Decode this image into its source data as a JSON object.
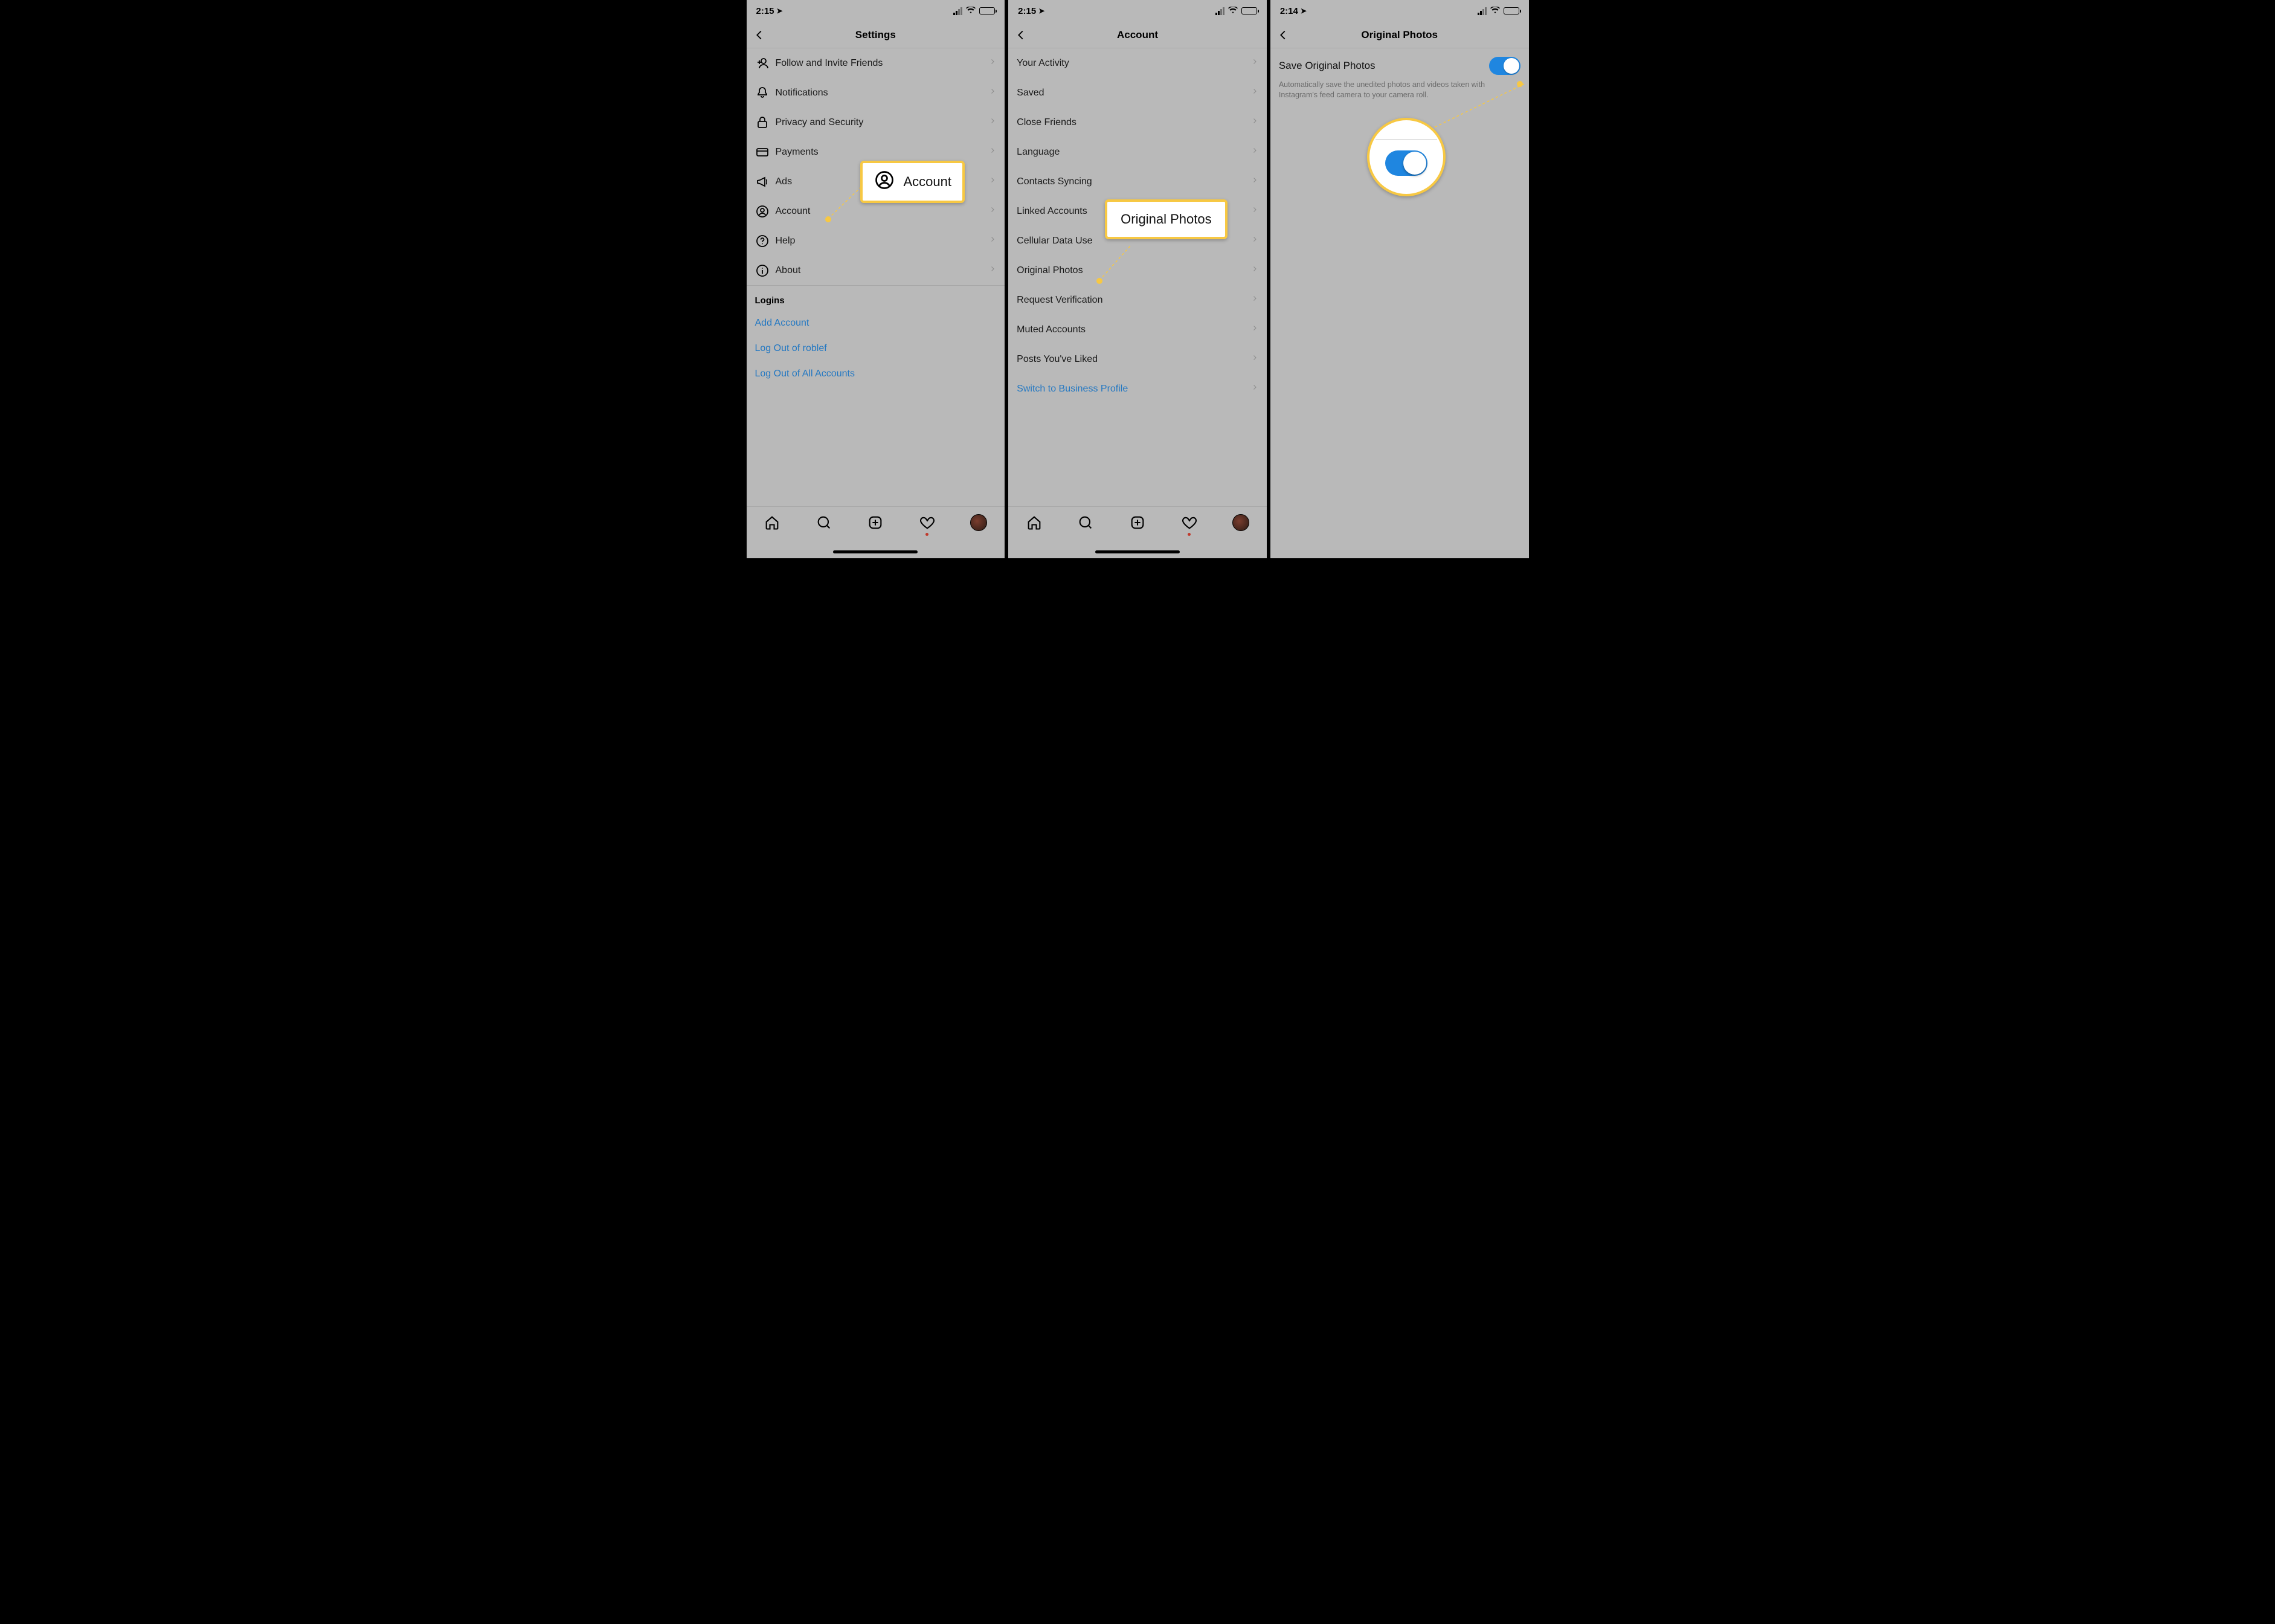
{
  "screens": {
    "settings": {
      "status_time": "2:15",
      "title": "Settings",
      "items": [
        {
          "label": "Follow and Invite Friends",
          "icon": "user-plus"
        },
        {
          "label": "Notifications",
          "icon": "bell"
        },
        {
          "label": "Privacy and Security",
          "icon": "lock"
        },
        {
          "label": "Payments",
          "icon": "card"
        },
        {
          "label": "Ads",
          "icon": "megaphone"
        },
        {
          "label": "Account",
          "icon": "user-circle"
        },
        {
          "label": "Help",
          "icon": "help"
        },
        {
          "label": "About",
          "icon": "info"
        }
      ],
      "logins_header": "Logins",
      "logins_links": [
        "Add Account",
        "Log Out of roblef",
        "Log Out of All Accounts"
      ],
      "callout_label": "Account"
    },
    "account": {
      "status_time": "2:15",
      "title": "Account",
      "items": [
        "Your Activity",
        "Saved",
        "Close Friends",
        "Language",
        "Contacts Syncing",
        "Linked Accounts",
        "Cellular Data Use",
        "Original Photos",
        "Request Verification",
        "Muted Accounts",
        "Posts You've Liked"
      ],
      "switch_label": "Switch to Business Profile",
      "callout_label": "Original Photos"
    },
    "original_photos": {
      "status_time": "2:14",
      "title": "Original Photos",
      "toggle_label": "Save Original Photos",
      "toggle_on": true,
      "description": "Automatically save the unedited photos and videos taken with Instagram's feed camera to your camera roll."
    }
  }
}
